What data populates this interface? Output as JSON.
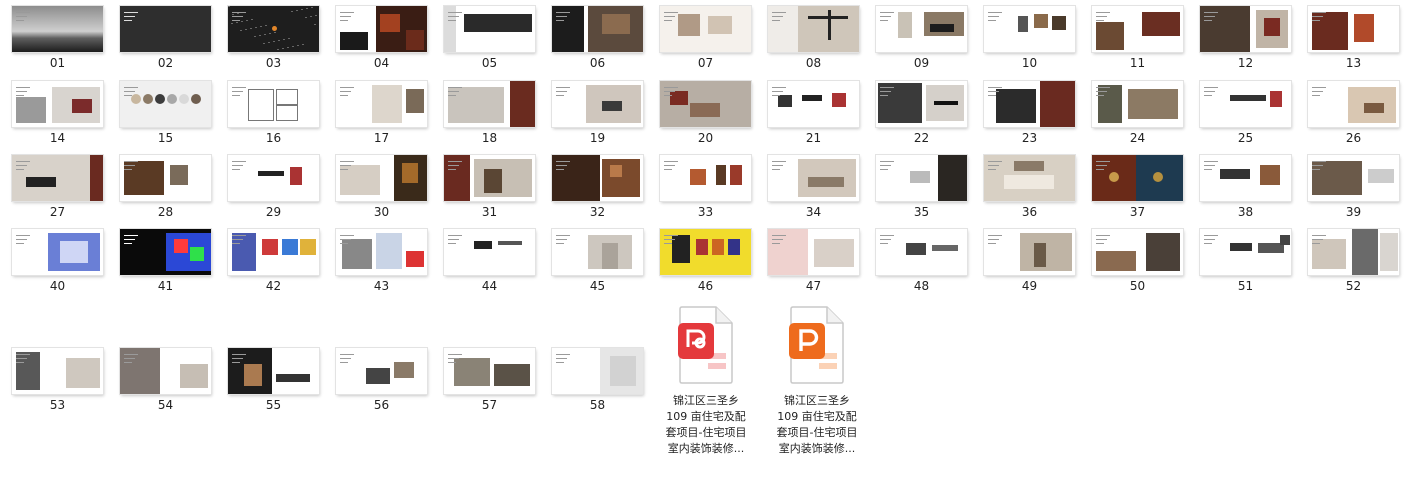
{
  "slides": [
    "01",
    "02",
    "03",
    "04",
    "05",
    "06",
    "07",
    "08",
    "09",
    "10",
    "11",
    "12",
    "13",
    "14",
    "15",
    "16",
    "17",
    "18",
    "19",
    "20",
    "21",
    "22",
    "23",
    "24",
    "25",
    "26",
    "27",
    "28",
    "29",
    "30",
    "31",
    "32",
    "33",
    "34",
    "35",
    "36",
    "37",
    "38",
    "39",
    "40",
    "41",
    "42",
    "43",
    "44",
    "45",
    "46",
    "47",
    "48",
    "49",
    "50",
    "51",
    "52",
    "53",
    "54",
    "55",
    "56",
    "57",
    "58"
  ],
  "files": [
    {
      "lines": [
        "锦江区三圣乡",
        "109 亩住宅及配",
        "套项目-住宅项目",
        "室内装饰装修..."
      ],
      "icon": "pdf-icon",
      "color": "#e4393c"
    },
    {
      "lines": [
        "锦江区三圣乡",
        "109 亩住宅及配",
        "套项目-住宅项目",
        "室内装饰装修..."
      ],
      "icon": "pptx-icon",
      "color": "#ee6b1d"
    }
  ]
}
